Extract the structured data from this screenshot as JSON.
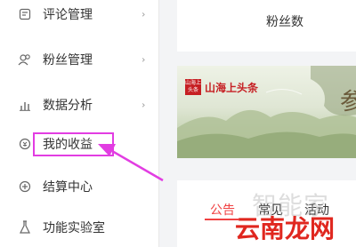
{
  "sidebar": {
    "items": [
      {
        "label": "评论管理",
        "icon": "comment-manage-icon",
        "has_chevron": true
      },
      {
        "label": "粉丝管理",
        "icon": "fans-icon",
        "has_chevron": true
      },
      {
        "label": "数据分析",
        "icon": "bar-chart-icon",
        "has_chevron": true
      },
      {
        "label": "我的收益",
        "icon": "earnings-icon",
        "has_chevron": false,
        "highlighted": true
      },
      {
        "label": "结算中心",
        "icon": "settlement-icon",
        "has_chevron": false
      },
      {
        "label": "功能实验室",
        "icon": "flask-icon",
        "has_chevron": false
      }
    ],
    "chevron": "›"
  },
  "main": {
    "fans_card_title": "粉丝数",
    "banner": {
      "logo_text": "山海上头条",
      "title": "山海上头条",
      "big_char": "参"
    },
    "tabs": [
      {
        "label": "公告",
        "active": true
      },
      {
        "label": "常见",
        "active": false
      },
      {
        "label": "活动",
        "active": false
      }
    ]
  },
  "watermarks": {
    "top": "智能家",
    "bottom": "云南龙网"
  },
  "colors": {
    "annotation": "#e23de2",
    "accent_red": "#f04142"
  }
}
